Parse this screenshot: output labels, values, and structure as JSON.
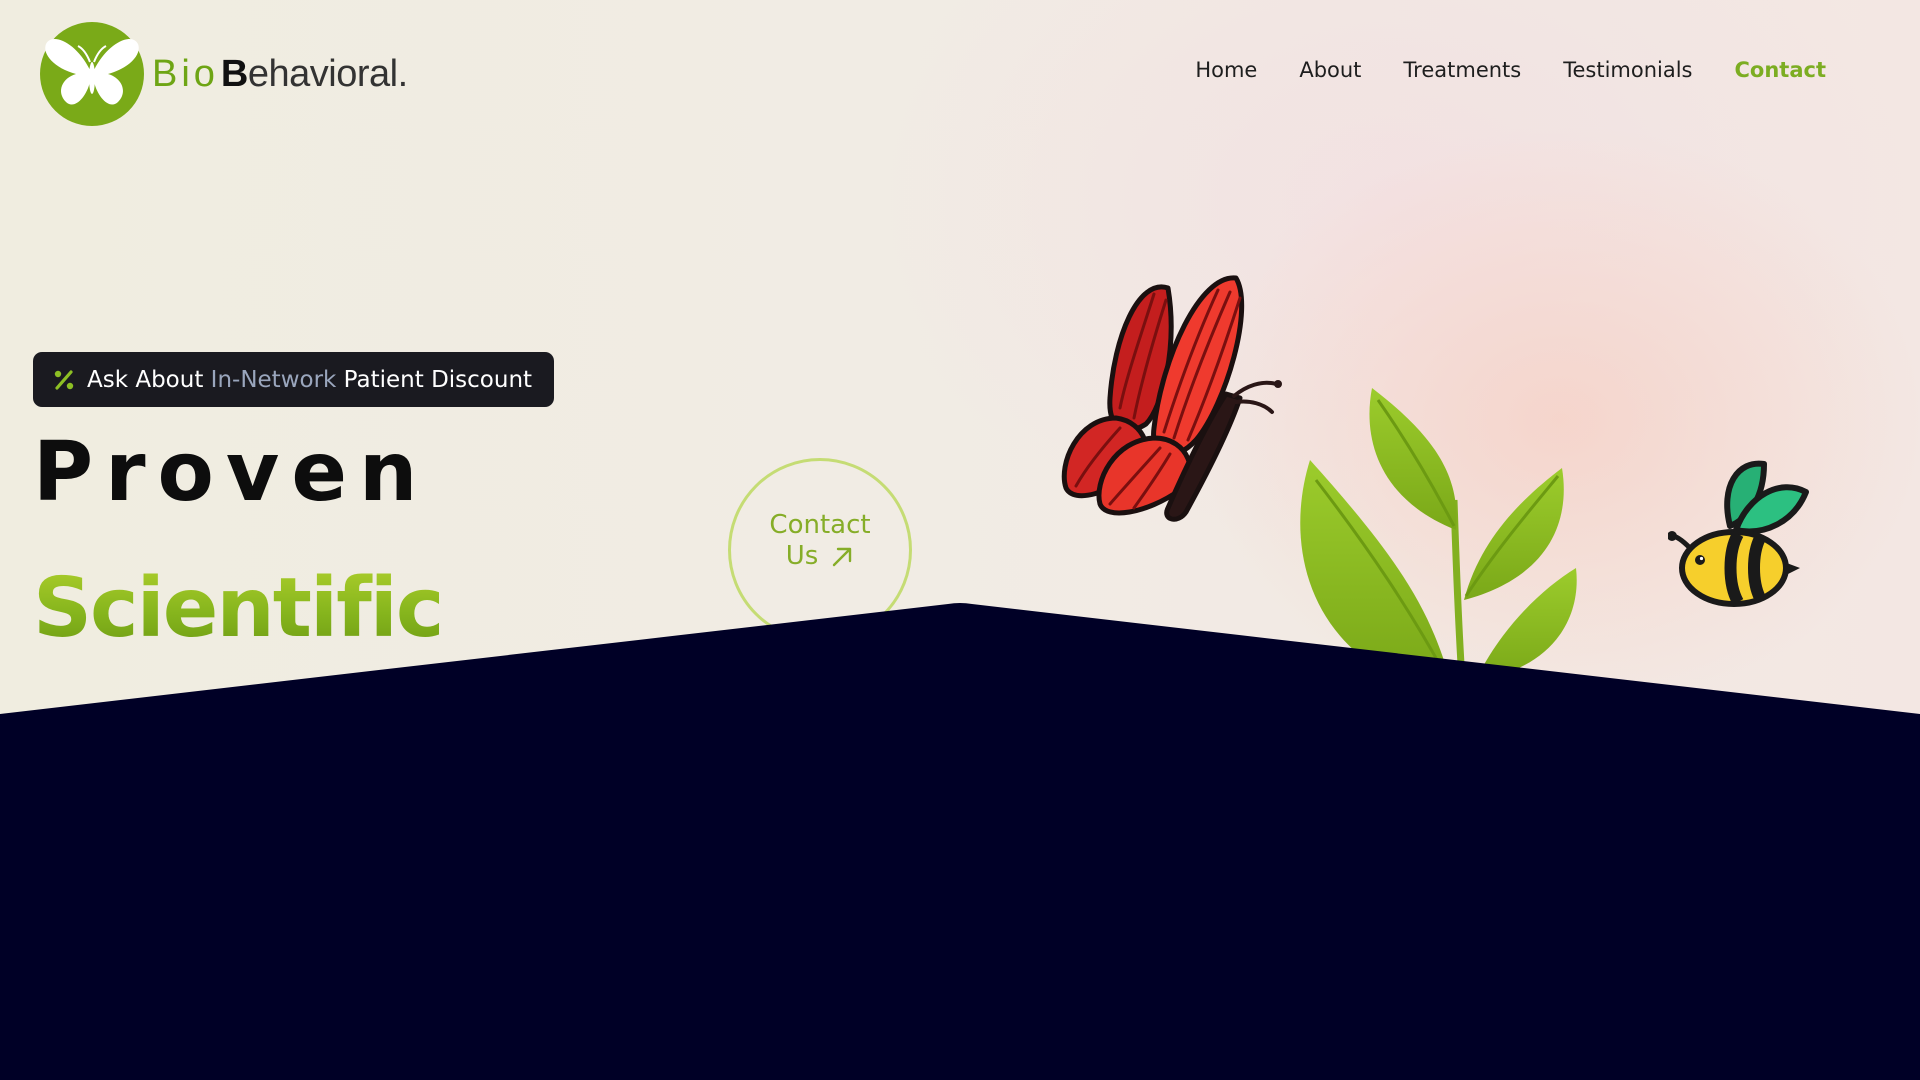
{
  "header": {
    "logo": {
      "part_bio": "Bio",
      "part_b": "B",
      "part_rest": "ehavioral."
    },
    "nav": [
      {
        "label": "Home",
        "active": false
      },
      {
        "label": "About",
        "active": false
      },
      {
        "label": "Treatments",
        "active": false
      },
      {
        "label": "Testimonials",
        "active": false
      },
      {
        "label": "Contact",
        "active": true
      }
    ]
  },
  "hero": {
    "badge": {
      "icon": "percent-icon",
      "prefix": "Ask About ",
      "highlight": "In-Network",
      "suffix": " Patient Discount"
    },
    "headline_line1": "Proven",
    "headline_line2": "Scientific",
    "cta": {
      "line1": "Contact",
      "line2": "Us",
      "icon": "arrow-up-right-icon"
    },
    "illustrations": [
      "butterfly-illustration",
      "plant-illustration",
      "bee-illustration"
    ]
  },
  "colors": {
    "brand_green": "#84b51f",
    "dark_navy": "#000026",
    "badge_bg": "#1a1a20",
    "badge_highlight": "#9aa6bd"
  }
}
